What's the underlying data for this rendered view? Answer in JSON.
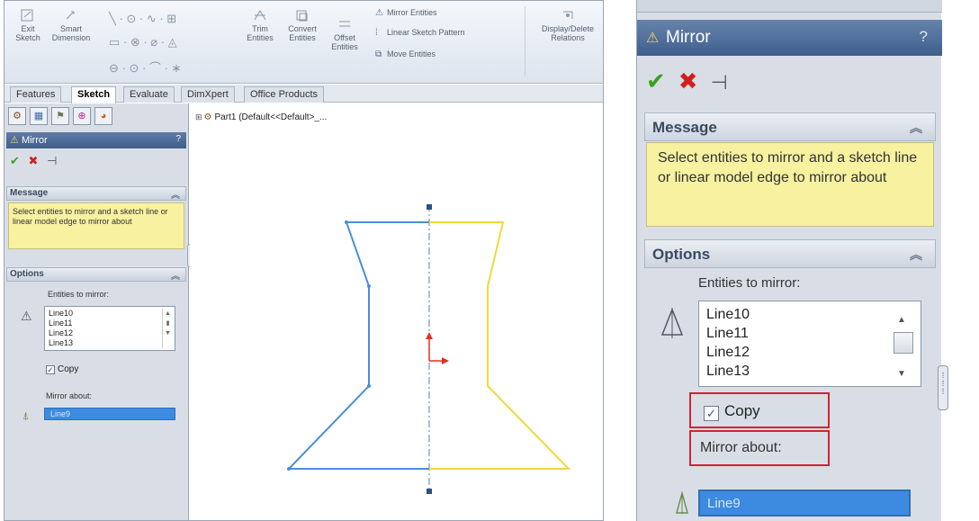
{
  "ribbon": {
    "exit_sketch": "Exit\nSketch",
    "smart_dimension": "Smart\nDimension",
    "trim_entities": "Trim\nEntities",
    "convert_entities": "Convert\nEntities",
    "offset_entities": "Offset\nEntities",
    "mirror_entities": "Mirror Entities",
    "linear_sketch_pattern": "Linear Sketch Pattern",
    "move_entities": "Move Entities",
    "display_delete_relations": "Display/Delete\nRelations"
  },
  "tabs": [
    "Features",
    "Sketch",
    "Evaluate",
    "DimXpert",
    "Office Products"
  ],
  "active_tab": "Sketch",
  "tree": {
    "root": "Part1  (Default<<Default>_..."
  },
  "property_manager": {
    "title": "Mirror",
    "help": "?",
    "message_header": "Message",
    "message": "Select entities to mirror and a sketch line or linear model edge to mirror about",
    "options_header": "Options",
    "entities_label": "Entities to mirror:",
    "entities": [
      "Line10",
      "Line11",
      "Line12",
      "Line13"
    ],
    "copy_label": "Copy",
    "copy_checked": true,
    "mirror_about_label": "Mirror about:",
    "mirror_about_value": "Line9"
  },
  "colors": {
    "original_sketch": "#4a8fd6",
    "mirrored_sketch": "#f0d83a",
    "centerline": "#5a7fb0",
    "highlight_box": "#d3232e",
    "message_bg": "#f7f1a0",
    "selection_bg": "#3c8be0"
  },
  "icons": {
    "ok": "check-icon",
    "cancel": "x-icon",
    "pin": "pushpin-icon",
    "mirror": "mirror-icon"
  }
}
